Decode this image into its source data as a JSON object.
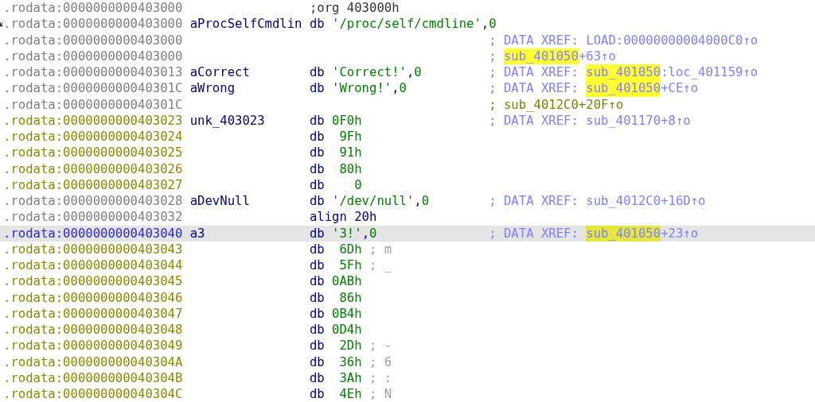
{
  "listing": {
    "rows": [
      {
        "address": ".rodata:0000000000403000",
        "kind": "string",
        "selected": false,
        "operand": [
          {
            "t": ";org 403000h",
            "kind": "directive"
          }
        ]
      },
      {
        "address": ".rodata:0000000000403000",
        "kind": "string",
        "selected": false,
        "arrow": true,
        "name": "aProcSelfCmdlin",
        "mnemonic": "db",
        "operand": [
          {
            "t": "'/proc/self/cmdline'",
            "kind": "value"
          },
          {
            "t": ",",
            "kind": "punct"
          },
          {
            "t": "0",
            "kind": "value"
          }
        ]
      },
      {
        "address": ".rodata:0000000000403000",
        "kind": "string",
        "selected": false,
        "comment": [
          {
            "t": "; DATA XREF: LOAD:00000000004000C0↑o",
            "kind": "xref",
            "highlighted": false
          }
        ]
      },
      {
        "address": ".rodata:0000000000403000",
        "kind": "string",
        "selected": false,
        "comment": [
          {
            "t": "; ",
            "kind": "xref",
            "highlighted": false
          },
          {
            "t": "sub_401050",
            "kind": "xref",
            "highlighted": true
          },
          {
            "t": "+63↑o",
            "kind": "xref",
            "highlighted": false
          }
        ]
      },
      {
        "address": ".rodata:0000000000403013",
        "kind": "string",
        "selected": false,
        "name": "aCorrect",
        "mnemonic": "db",
        "operand": [
          {
            "t": "'Correct!'",
            "kind": "value"
          },
          {
            "t": ",",
            "kind": "punct"
          },
          {
            "t": "0",
            "kind": "value"
          }
        ],
        "comment": [
          {
            "t": "; DATA XREF: ",
            "kind": "xref",
            "highlighted": false
          },
          {
            "t": "sub_401050",
            "kind": "xref",
            "highlighted": true
          },
          {
            "t": ":loc_401159↑o",
            "kind": "xref",
            "highlighted": false
          }
        ]
      },
      {
        "address": ".rodata:000000000040301C",
        "kind": "string",
        "selected": false,
        "name": "aWrong",
        "mnemonic": "db",
        "operand": [
          {
            "t": "'Wrong!'",
            "kind": "value"
          },
          {
            "t": ",",
            "kind": "punct"
          },
          {
            "t": "0",
            "kind": "value"
          }
        ],
        "comment": [
          {
            "t": "; DATA XREF: ",
            "kind": "xref",
            "highlighted": false
          },
          {
            "t": "sub_401050",
            "kind": "xref",
            "highlighted": true
          },
          {
            "t": "+CE↑o",
            "kind": "xref",
            "highlighted": false
          }
        ]
      },
      {
        "address": ".rodata:000000000040301C",
        "kind": "string",
        "selected": false,
        "comment": [
          {
            "t": "; sub_4012C0+20F↑o",
            "kind": "repeat",
            "highlighted": false
          }
        ]
      },
      {
        "address": ".rodata:0000000000403023",
        "kind": "bytes",
        "selected": false,
        "name": "unk_403023",
        "mnemonic": "db",
        "operand": [
          {
            "t": "0F0h",
            "kind": "value"
          }
        ],
        "comment": [
          {
            "t": "; DATA XREF: sub_401170+8↑o",
            "kind": "xref",
            "highlighted": false
          }
        ]
      },
      {
        "address": ".rodata:0000000000403024",
        "kind": "bytes",
        "selected": false,
        "mnemonic": "db",
        "operand": [
          {
            "t": " 9Fh",
            "kind": "value"
          }
        ]
      },
      {
        "address": ".rodata:0000000000403025",
        "kind": "bytes",
        "selected": false,
        "mnemonic": "db",
        "operand": [
          {
            "t": " 91h",
            "kind": "value"
          }
        ]
      },
      {
        "address": ".rodata:0000000000403026",
        "kind": "bytes",
        "selected": false,
        "mnemonic": "db",
        "operand": [
          {
            "t": " 80h",
            "kind": "value"
          }
        ]
      },
      {
        "address": ".rodata:0000000000403027",
        "kind": "bytes",
        "selected": false,
        "mnemonic": "db",
        "operand": [
          {
            "t": "   0",
            "kind": "value"
          }
        ]
      },
      {
        "address": ".rodata:0000000000403028",
        "kind": "string",
        "selected": false,
        "name": "aDevNull",
        "mnemonic": "db",
        "operand": [
          {
            "t": "'/dev/null'",
            "kind": "value"
          },
          {
            "t": ",",
            "kind": "punct"
          },
          {
            "t": "0",
            "kind": "value"
          }
        ],
        "comment": [
          {
            "t": "; DATA XREF: sub_4012C0+16D↑o",
            "kind": "xref",
            "highlighted": false
          }
        ]
      },
      {
        "address": ".rodata:0000000000403032",
        "kind": "string",
        "selected": false,
        "mnemonic": "align",
        "operand": [
          {
            "t": "20h",
            "kind": "punct"
          }
        ]
      },
      {
        "address": ".rodata:0000000000403040",
        "kind": "string",
        "selected": true,
        "name": "a3",
        "mnemonic": "db",
        "operand": [
          {
            "t": "'3!'",
            "kind": "value"
          },
          {
            "t": ",",
            "kind": "punct"
          },
          {
            "t": "0",
            "kind": "value"
          }
        ],
        "comment": [
          {
            "t": "; DATA XREF: ",
            "kind": "xref",
            "highlighted": false
          },
          {
            "t": "sub_401050",
            "kind": "xref",
            "highlighted": true
          },
          {
            "t": "+23↑o",
            "kind": "xref",
            "highlighted": false
          }
        ]
      },
      {
        "address": ".rodata:0000000000403043",
        "kind": "bytes",
        "selected": false,
        "mnemonic": "db",
        "operand": [
          {
            "t": " 6Dh",
            "kind": "value"
          },
          {
            "t": " ; m",
            "kind": "comment"
          }
        ]
      },
      {
        "address": ".rodata:0000000000403044",
        "kind": "bytes",
        "selected": false,
        "mnemonic": "db",
        "operand": [
          {
            "t": " 5Fh",
            "kind": "value"
          },
          {
            "t": " ; _",
            "kind": "comment"
          }
        ]
      },
      {
        "address": ".rodata:0000000000403045",
        "kind": "bytes",
        "selected": false,
        "mnemonic": "db",
        "operand": [
          {
            "t": "0ABh",
            "kind": "value"
          }
        ]
      },
      {
        "address": ".rodata:0000000000403046",
        "kind": "bytes",
        "selected": false,
        "mnemonic": "db",
        "operand": [
          {
            "t": " 86h",
            "kind": "value"
          }
        ]
      },
      {
        "address": ".rodata:0000000000403047",
        "kind": "bytes",
        "selected": false,
        "mnemonic": "db",
        "operand": [
          {
            "t": "0B4h",
            "kind": "value"
          }
        ]
      },
      {
        "address": ".rodata:0000000000403048",
        "kind": "bytes",
        "selected": false,
        "mnemonic": "db",
        "operand": [
          {
            "t": "0D4h",
            "kind": "value"
          }
        ]
      },
      {
        "address": ".rodata:0000000000403049",
        "kind": "bytes",
        "selected": false,
        "mnemonic": "db",
        "operand": [
          {
            "t": " 2Dh",
            "kind": "value"
          },
          {
            "t": " ; -",
            "kind": "comment"
          }
        ]
      },
      {
        "address": ".rodata:000000000040304A",
        "kind": "bytes",
        "selected": false,
        "mnemonic": "db",
        "operand": [
          {
            "t": " 36h",
            "kind": "value"
          },
          {
            "t": " ; 6",
            "kind": "comment"
          }
        ]
      },
      {
        "address": ".rodata:000000000040304B",
        "kind": "bytes",
        "selected": false,
        "mnemonic": "db",
        "operand": [
          {
            "t": " 3Ah",
            "kind": "value"
          },
          {
            "t": " ; :",
            "kind": "comment"
          }
        ]
      },
      {
        "address": ".rodata:000000000040304C",
        "kind": "bytes",
        "selected": false,
        "mnemonic": "db",
        "operand": [
          {
            "t": " 4Eh",
            "kind": "value"
          },
          {
            "t": " ; N",
            "kind": "comment"
          }
        ]
      }
    ]
  }
}
